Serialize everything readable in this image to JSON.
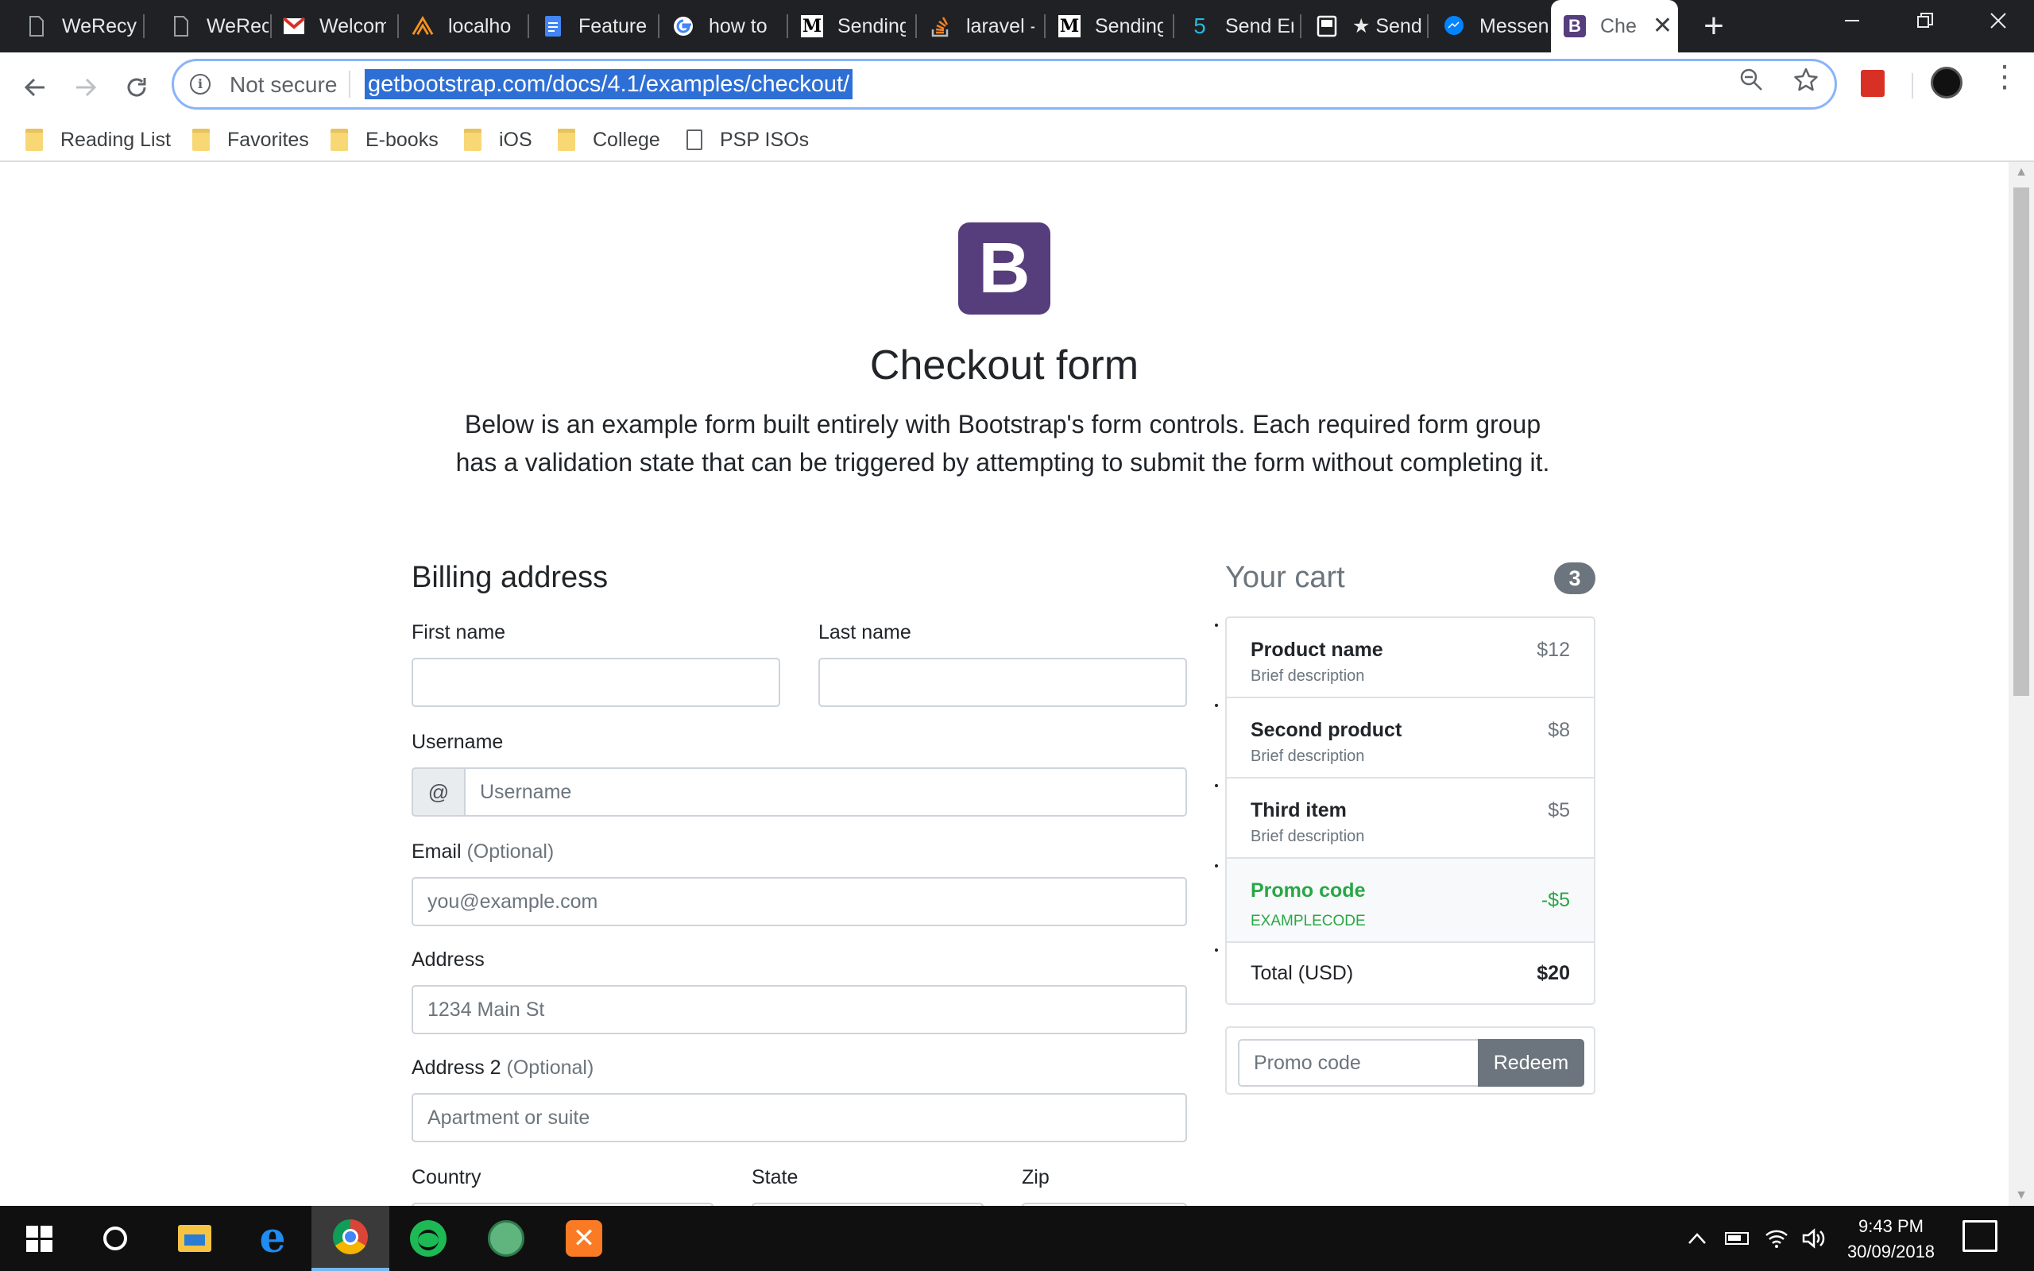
{
  "browser": {
    "tabs": [
      {
        "title": "WeRecy",
        "icon": "doc-icon"
      },
      {
        "title": "WeRecy",
        "icon": "doc-icon"
      },
      {
        "title": "Welcom",
        "icon": "gmail-icon"
      },
      {
        "title": "localho",
        "icon": "xampp-icon"
      },
      {
        "title": "Feature",
        "icon": "google-docs-icon"
      },
      {
        "title": "how to",
        "icon": "google-icon"
      },
      {
        "title": "Sending",
        "icon": "medium-icon"
      },
      {
        "title": "laravel -",
        "icon": "stackoverflow-icon"
      },
      {
        "title": "Sending",
        "icon": "medium-icon"
      },
      {
        "title": "Send Er",
        "icon": "five-icon"
      },
      {
        "title": "★ Send",
        "icon": "device-icon"
      },
      {
        "title": "Messen",
        "icon": "messenger-icon"
      },
      {
        "title": "Che",
        "icon": "bootstrap-icon",
        "active": true
      }
    ],
    "omnibox": {
      "security_label": "Not secure",
      "url": "getbootstrap.com/docs/4.1/examples/checkout/"
    },
    "bookmarks": [
      {
        "label": "Reading List",
        "type": "folder"
      },
      {
        "label": "Favorites",
        "type": "folder"
      },
      {
        "label": "E-books",
        "type": "folder"
      },
      {
        "label": "iOS",
        "type": "folder"
      },
      {
        "label": "College",
        "type": "folder"
      },
      {
        "label": "PSP ISOs",
        "type": "page"
      }
    ]
  },
  "page": {
    "logo_letter": "B",
    "title": "Checkout form",
    "lead": "Below is an example form built entirely with Bootstrap's form controls. Each required form group has a validation state that can be triggered by attempting to submit the form without completing it.",
    "billing": {
      "heading": "Billing address",
      "first_name_label": "First name",
      "last_name_label": "Last name",
      "username_label": "Username",
      "username_addon": "@",
      "username_placeholder": "Username",
      "email_label": "Email",
      "email_optional": "(Optional)",
      "email_placeholder": "you@example.com",
      "address_label": "Address",
      "address_placeholder": "1234 Main St",
      "address2_label": "Address 2",
      "address2_optional": "(Optional)",
      "address2_placeholder": "Apartment or suite",
      "country_label": "Country",
      "state_label": "State",
      "zip_label": "Zip"
    },
    "cart": {
      "heading": "Your cart",
      "count": "3",
      "items": [
        {
          "name": "Product name",
          "desc": "Brief description",
          "price": "$12"
        },
        {
          "name": "Second product",
          "desc": "Brief description",
          "price": "$8"
        },
        {
          "name": "Third item",
          "desc": "Brief description",
          "price": "$5"
        }
      ],
      "promo": {
        "name": "Promo code",
        "code": "EXAMPLECODE",
        "amount": "-$5"
      },
      "total": {
        "label": "Total (USD)",
        "amount": "$20"
      },
      "promo_placeholder": "Promo code",
      "redeem_label": "Redeem"
    }
  },
  "taskbar": {
    "apps": [
      "start-button",
      "cortana-button",
      "file-explorer",
      "edge",
      "chrome",
      "spotify",
      "atom",
      "xampp"
    ],
    "time": "9:43 PM",
    "date": "30/09/2018"
  },
  "colors": {
    "bootstrap_purple": "#563d7c",
    "success_green": "#28a745",
    "secondary_gray": "#6c757d",
    "omnibox_selection": "#2e6fd6"
  }
}
